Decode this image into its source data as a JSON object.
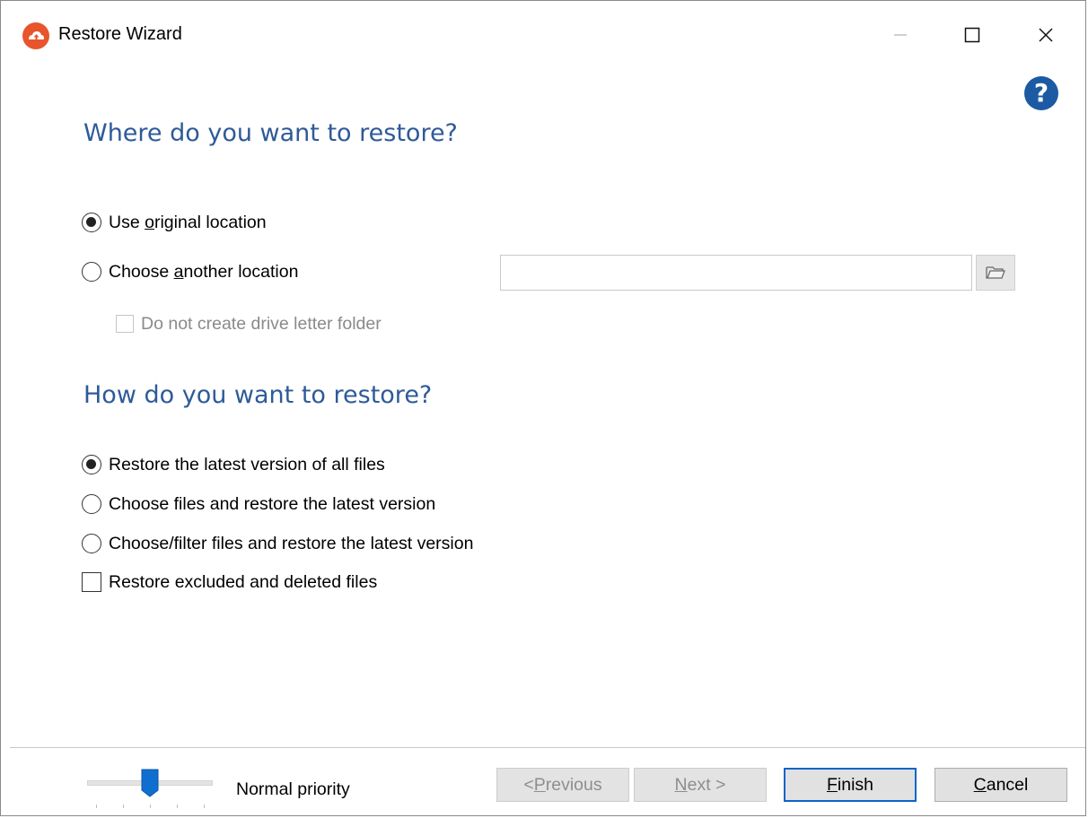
{
  "window": {
    "title": "Restore Wizard",
    "app_icon": "backup-cloud-icon",
    "controls": {
      "minimize_icon": "minimize-icon",
      "maximize_icon": "maximize-icon",
      "close_icon": "close-icon"
    }
  },
  "help": {
    "icon": "help-icon",
    "symbol": "?"
  },
  "location_section": {
    "heading": "Where do you want to restore?",
    "use_original": {
      "prefix": "Use ",
      "accel": "o",
      "suffix": "riginal location",
      "checked": true
    },
    "choose_another": {
      "prefix": "Choose ",
      "accel": "a",
      "suffix": "nother location",
      "checked": false
    },
    "path_input": {
      "value": "",
      "placeholder": ""
    },
    "browse_icon": "folder-open-icon",
    "no_drive_letter": {
      "label": "Do not create drive letter folder",
      "checked": false,
      "enabled": false
    }
  },
  "restore_section": {
    "heading": "How do you want to restore?",
    "options": [
      {
        "label": "Restore the latest version of all files",
        "checked": true
      },
      {
        "label": "Choose files and restore the latest version",
        "checked": false
      },
      {
        "label": "Choose/filter files and restore the latest version",
        "checked": false
      }
    ],
    "restore_excluded": {
      "label": "Restore excluded and deleted files",
      "checked": false
    }
  },
  "footer": {
    "priority_label": "Normal priority",
    "priority_level": 0.5,
    "buttons": {
      "previous": {
        "prefix": "< ",
        "accel": "P",
        "suffix": "revious",
        "enabled": false
      },
      "next": {
        "prefix": "",
        "accel": "N",
        "suffix": "ext >",
        "enabled": false
      },
      "finish": {
        "prefix": "",
        "accel": "F",
        "suffix": "inish",
        "enabled": true
      },
      "cancel": {
        "prefix": "",
        "accel": "C",
        "suffix": "ancel",
        "enabled": true
      }
    }
  },
  "colors": {
    "heading": "#2e5a98",
    "app_icon": "#e8542c",
    "help_icon": "#1c5aa3",
    "default_button_border": "#0a64c8"
  }
}
